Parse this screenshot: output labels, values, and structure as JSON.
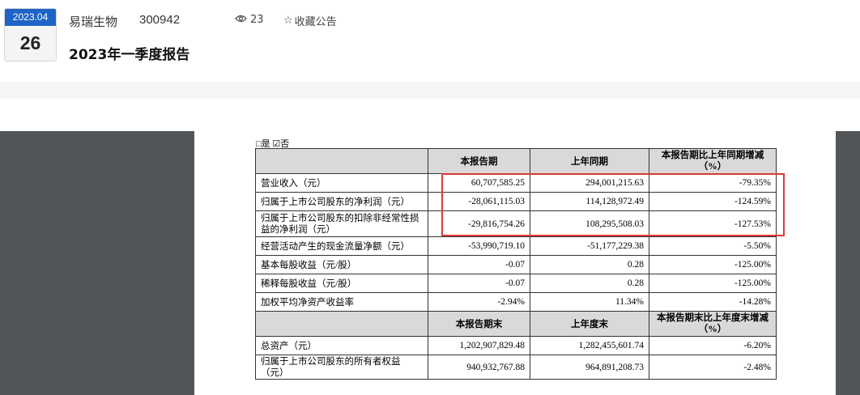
{
  "header": {
    "date_month": "2023.04",
    "date_day": "26",
    "company": "易瑞生物",
    "code": "300942",
    "views": "23",
    "favorite_label": "收藏公告",
    "title": "2023年一季度报告"
  },
  "document": {
    "radio_line": "是 ☑否",
    "table": {
      "headers": [
        "",
        "本报告期",
        "上年同期",
        "本报告期比上年同期增减（%）"
      ],
      "rows": [
        {
          "label": "营业收入（元）",
          "current": "60,707,585.25",
          "prior": "294,001,215.63",
          "change": "-79.35%"
        },
        {
          "label": "归属于上市公司股东的净利润（元）",
          "current": "-28,061,115.03",
          "prior": "114,128,972.49",
          "change": "-124.59%"
        },
        {
          "label": "归属于上市公司股东的扣除非经常性损益的净利润（元）",
          "current": "-29,816,754.26",
          "prior": "108,295,508.03",
          "change": "-127.53%"
        },
        {
          "label": "经营活动产生的现金流量净额（元）",
          "current": "-53,990,719.10",
          "prior": "-51,177,229.38",
          "change": "-5.50%"
        },
        {
          "label": "基本每股收益（元/股）",
          "current": "-0.07",
          "prior": "0.28",
          "change": "-125.00%"
        },
        {
          "label": "稀释每股收益（元/股）",
          "current": "-0.07",
          "prior": "0.28",
          "change": "-125.00%"
        },
        {
          "label": "加权平均净资产收益率",
          "current": "-2.94%",
          "prior": "11.34%",
          "change": "-14.28%"
        }
      ],
      "headers2": [
        "",
        "本报告期末",
        "上年度末",
        "本报告期末比上年度末增减（%）"
      ],
      "rows2": [
        {
          "label": "总资产（元）",
          "current": "1,202,907,829.48",
          "prior": "1,282,455,601.74",
          "change": "-6.20%"
        },
        {
          "label": "归属于上市公司股东的所有者权益（元）",
          "current": "940,932,767.88",
          "prior": "964,891,208.73",
          "change": "-2.48%"
        }
      ]
    }
  },
  "colors": {
    "date_badge": "#1f63c6",
    "highlight_border": "#d93a3a",
    "viewer_bg": "#525659",
    "table_header_bg": "#d9d9d9"
  }
}
